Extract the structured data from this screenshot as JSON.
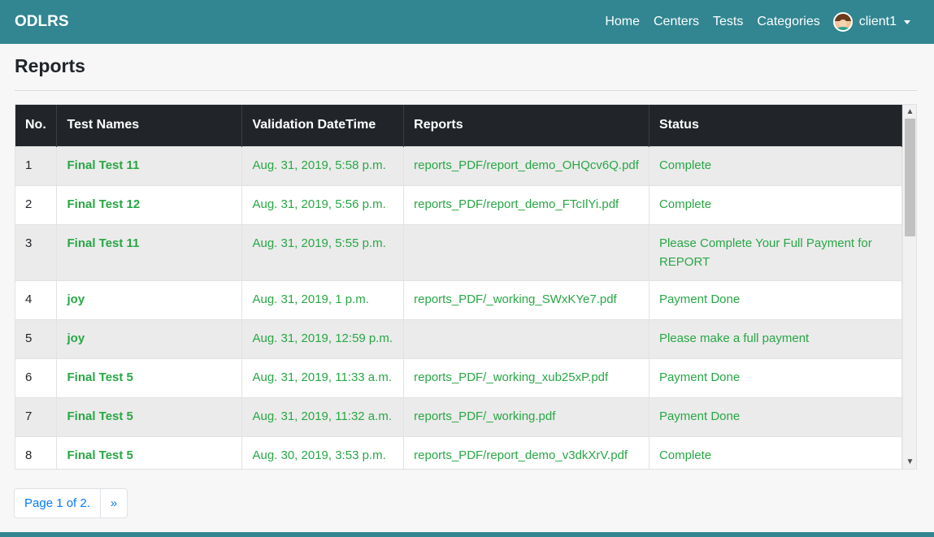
{
  "navbar": {
    "brand": "ODLRS",
    "links": [
      "Home",
      "Centers",
      "Tests",
      "Categories"
    ],
    "user": "client1"
  },
  "page": {
    "title": "Reports"
  },
  "table": {
    "headers": [
      "No.",
      "Test Names",
      "Validation DateTime",
      "Reports",
      "Status"
    ],
    "rows": [
      [
        "1",
        "Final Test 11",
        "Aug. 31, 2019, 5:58 p.m.",
        "reports_PDF/report_demo_OHQcv6Q.pdf",
        "Complete"
      ],
      [
        "2",
        "Final Test 12",
        "Aug. 31, 2019, 5:56 p.m.",
        "reports_PDF/report_demo_FTcIlYi.pdf",
        "Complete"
      ],
      [
        "3",
        "Final Test 11",
        "Aug. 31, 2019, 5:55 p.m.",
        "",
        "Please Complete Your Full Payment for REPORT"
      ],
      [
        "4",
        "joy",
        "Aug. 31, 2019, 1 p.m.",
        "reports_PDF/_working_SWxKYe7.pdf",
        "Payment Done"
      ],
      [
        "5",
        "joy",
        "Aug. 31, 2019, 12:59 p.m.",
        "",
        "Please make a full payment"
      ],
      [
        "6",
        "Final Test 5",
        "Aug. 31, 2019, 11:33 a.m.",
        "reports_PDF/_working_xub25xP.pdf",
        "Payment Done"
      ],
      [
        "7",
        "Final Test 5",
        "Aug. 31, 2019, 11:32 a.m.",
        "reports_PDF/_working.pdf",
        "Payment Done"
      ],
      [
        "8",
        "Final Test 5",
        "Aug. 30, 2019, 3:53 p.m.",
        "reports_PDF/report_demo_v3dkXrV.pdf",
        "Complete"
      ]
    ]
  },
  "pagination": {
    "page_label": "Page 1 of 2.",
    "next_label": "»"
  },
  "icons": {
    "avatar": "user-avatar-icon",
    "caret": "caret-down-icon",
    "scroll_up": "chevron-up-icon",
    "scroll_down": "chevron-down-icon"
  },
  "colors": {
    "navbar": "#318691",
    "table_header": "#212529",
    "cell_text": "#28a745",
    "link": "#007bff"
  }
}
